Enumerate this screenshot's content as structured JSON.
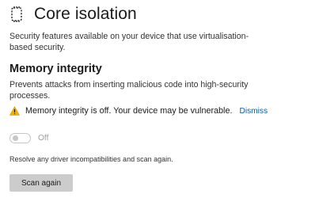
{
  "header": {
    "title": "Core isolation",
    "icon": "core-isolation-chip-icon"
  },
  "intro": {
    "description": "Security features available on your device that use virtualisation-based security."
  },
  "memory_integrity": {
    "title": "Memory integrity",
    "description": "Prevents attacks from inserting malicious code into high-security processes.",
    "warning": {
      "icon": "warning-icon",
      "icon_color": "#f0b400",
      "text": "Memory integrity is off. Your device may be vulnerable.",
      "dismiss_label": "Dismiss",
      "link_color": "#0a5aa5"
    },
    "toggle": {
      "state_label": "Off",
      "on": false,
      "disabled": true
    },
    "resolve_text": "Resolve any driver incompatibilities and scan again.",
    "scan_button_label": "Scan again"
  }
}
